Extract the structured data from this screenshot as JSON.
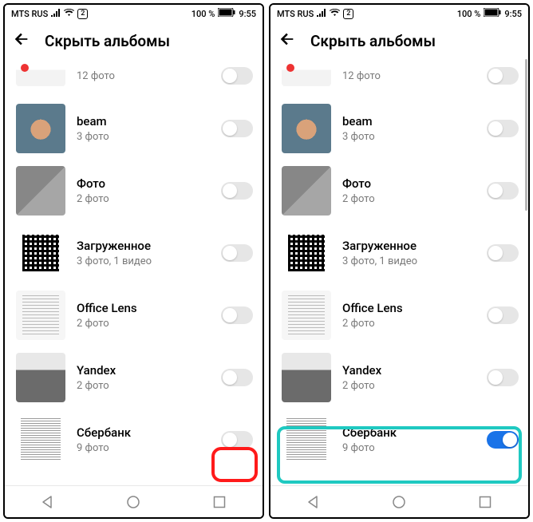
{
  "statusbar": {
    "carrier": "MTS RUS",
    "sim_badge": "2",
    "battery_text": "100 %",
    "time": "9:55"
  },
  "header": {
    "title": "Скрыть альбомы"
  },
  "albums": [
    {
      "name": "",
      "count": "12 фото"
    },
    {
      "name": "beam",
      "count": "3 фото"
    },
    {
      "name": "Фото",
      "count": "2 фото"
    },
    {
      "name": "Загруженное",
      "count": "3 фото,  1 видео"
    },
    {
      "name": "Office Lens",
      "count": "2 фото"
    },
    {
      "name": "Yandex",
      "count": "2 фото"
    },
    {
      "name": "Сбербанк",
      "count": "9 фото"
    }
  ],
  "screens": {
    "left": {
      "sber_toggle_on": false
    },
    "right": {
      "sber_toggle_on": true
    }
  }
}
